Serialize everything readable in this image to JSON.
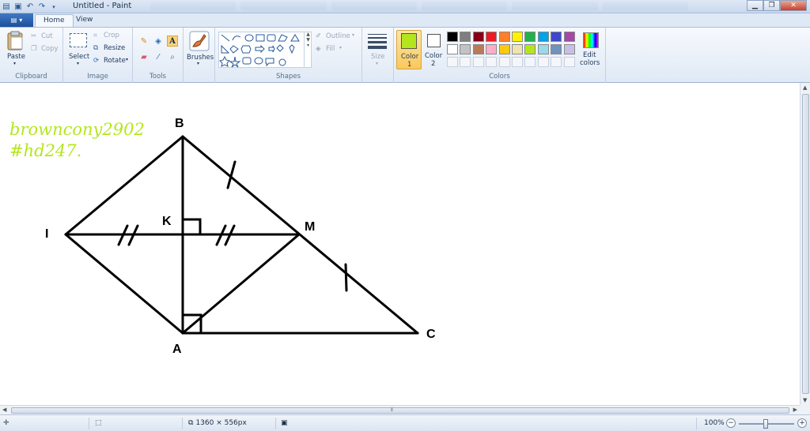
{
  "window": {
    "title": "Untitled - Paint"
  },
  "tabs": [
    {
      "label": "Home"
    },
    {
      "label": "View"
    }
  ],
  "ribbon": {
    "clipboard": {
      "group": "Clipboard",
      "paste": "Paste",
      "cut": "Cut",
      "copy": "Copy"
    },
    "image": {
      "group": "Image",
      "select": "Select",
      "crop": "Crop",
      "resize": "Resize",
      "rotate": "Rotate"
    },
    "tools": {
      "group": "Tools"
    },
    "brushes": {
      "label": "Brushes"
    },
    "shapes": {
      "group": "Shapes",
      "outline": "Outline",
      "fill": "Fill"
    },
    "size": {
      "label": "Size"
    },
    "colors": {
      "group": "Colors",
      "color1": "Color 1",
      "color1_num": "1",
      "color1_word": "Color",
      "color2_word": "Color",
      "color2_num": "2",
      "edit": "Edit",
      "edit2": "colors",
      "color1_value": "#b5e61d",
      "color2_value": "#ffffff",
      "palette_row1": [
        "#000000",
        "#7f7f7f",
        "#880015",
        "#ed1c24",
        "#ff7f27",
        "#fff200",
        "#22b14c",
        "#00a2e8",
        "#3f48cc",
        "#a349a4"
      ],
      "palette_row2": [
        "#ffffff",
        "#c3c3c3",
        "#b97a57",
        "#ffaec9",
        "#ffc90e",
        "#efe4b0",
        "#b5e61d",
        "#99d9ea",
        "#7092be",
        "#c8bfe7"
      ]
    }
  },
  "drawing": {
    "watermark_line1": "browncony2902",
    "watermark_line2": "#hd247.",
    "labels": {
      "B": "B",
      "I": "I",
      "K": "K",
      "M": "M",
      "A": "A",
      "C": "C"
    },
    "watermark_color": "#b5e61d"
  },
  "status": {
    "dimensions": "1360 × 556px",
    "zoom": "100%"
  }
}
